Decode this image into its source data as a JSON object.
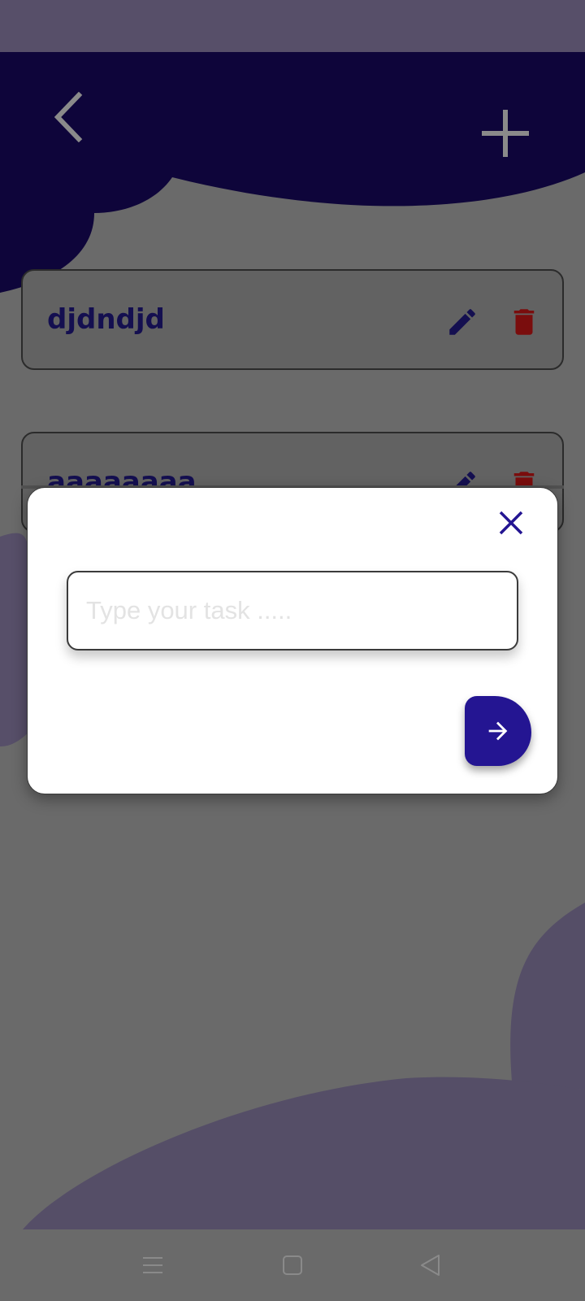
{
  "colors": {
    "header_blob": "#0e053a",
    "accent": "#241592",
    "task_title": "#140f50",
    "delete": "#7a0d0d",
    "bottom_blob": "#554e67"
  },
  "header": {
    "back_icon": "chevron-left-icon",
    "add_icon": "plus-icon"
  },
  "tasks": [
    {
      "title": "djdndjd",
      "edit_icon": "pencil-icon",
      "delete_icon": "trash-icon"
    },
    {
      "title": "aaaaaaaa",
      "edit_icon": "pencil-icon",
      "delete_icon": "trash-icon"
    }
  ],
  "dialog": {
    "close_icon": "close-icon",
    "input_value": "",
    "input_placeholder": "Type your task .....",
    "submit_icon": "arrow-right-icon"
  },
  "navbar": {
    "menu_icon": "menu-icon",
    "home_icon": "square-home-icon",
    "back_icon": "triangle-back-icon"
  }
}
